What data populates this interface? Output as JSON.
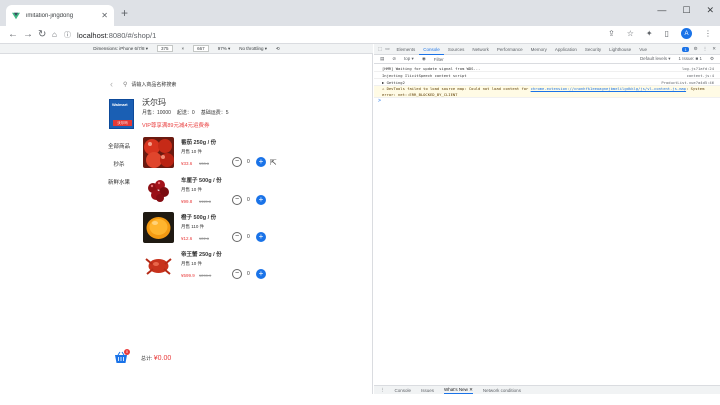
{
  "browser": {
    "tab_title": "imitation-jingdong",
    "new_tab": "+",
    "url_host": "localhost",
    "url_path": ":8080/#/shop/1",
    "avatar_letter": "A"
  },
  "device_toolbar": {
    "device": "Dimensions: iPhone 6/7/8 ▾",
    "width": "375",
    "times": "×",
    "height": "667",
    "zoom": "97% ▾",
    "throttle": "No throttling ▾"
  },
  "shop": {
    "search_placeholder": "请输入商品名称搜索",
    "logo_text": "Walmart",
    "logo_tag": "沃尔玛",
    "name": "沃尔玛",
    "monthly_sales": "月售：10000",
    "min_order": "起送：0",
    "delivery_fee": "基础运费：5",
    "coupon": "VIP尊享满89元减4元运费券"
  },
  "categories": [
    "全部商品",
    "秒杀",
    "新鲜水果"
  ],
  "products": [
    {
      "name": "番茄 250g / 份",
      "sales": "月售 10 件",
      "price": "¥33.6",
      "orig": "¥33.6",
      "qty": "0"
    },
    {
      "name": "车厘子 500g / 份",
      "sales": "月售 10 件",
      "price": "¥99.8",
      "orig": "¥115.6",
      "qty": "0"
    },
    {
      "name": "橙子 500g / 份",
      "sales": "月售 110 件",
      "price": "¥12.6",
      "orig": "¥22.6",
      "qty": "0"
    },
    {
      "name": "帝王蟹 250g / 份",
      "sales": "月售 10 件",
      "price": "¥599.9",
      "orig": "¥299.9",
      "qty": "0"
    }
  ],
  "cart": {
    "badge": "0",
    "total_label": "总计:",
    "total_amount": "¥0.00"
  },
  "devtools": {
    "tabs": [
      "Elements",
      "Console",
      "Sources",
      "Network",
      "Performance",
      "Memory",
      "Application",
      "Security",
      "Lighthouse",
      "Vue"
    ],
    "active_tab": "Console",
    "badge_count": "1",
    "context": "top ▾",
    "filter_placeholder": "Filter",
    "levels": "Default levels ▾",
    "issues": "1 Issue: ■ 1",
    "logs": [
      {
        "text": "[HMR] Waiting for update signal from WDS...",
        "src": "log.js?1afd:24"
      },
      {
        "text": "Injecting IlicitSpeech content script",
        "src": "content.js:4"
      },
      {
        "text": "▶ Getting2",
        "src": "ProductList.vue?a4d5:46"
      }
    ],
    "warning_prefix": "DevTools failed to load source map: Could not load content for ",
    "warning_link": "chrome-extension://cnonhfk1eeoagnejbmelilgdkklg/js/vl-content.js.map",
    "warning_suffix": ": System error: net::ERR_BLOCKED_BY_CLIENT",
    "prompt": ">",
    "drawer_tabs": [
      "Console",
      "Issues",
      "What's New ✕",
      "Network conditions"
    ],
    "drawer_active": "What's New ✕"
  }
}
